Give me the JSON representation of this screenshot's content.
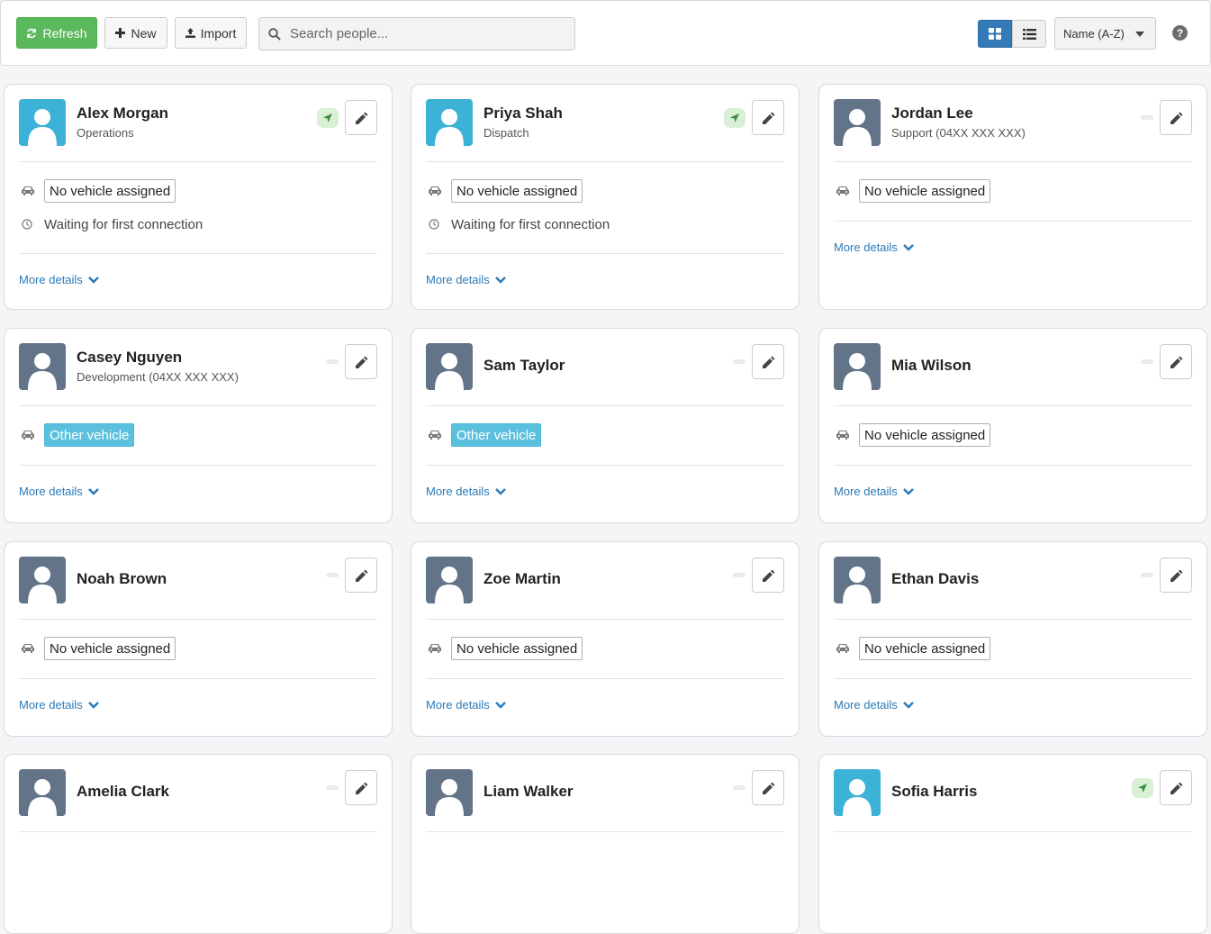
{
  "toolbar": {
    "refresh_label": "Refresh",
    "new_label": "New",
    "import_label": "Import",
    "search_placeholder": "Search people...",
    "sort_value": "Name (A-Z)",
    "help_label": "?"
  },
  "colors": {
    "accent": "#337ab7",
    "refresh": "#5cb85c",
    "avatar_online": "#3bb2d6",
    "avatar_offline": "#637388",
    "link": "#2a7ab8",
    "other_vehicle": "#5bc0de"
  },
  "people": [
    {
      "name": "Alex Morgan",
      "subtitle": "Operations",
      "vehicle": "No vehicle assigned",
      "vehicle_type": "none",
      "status": "Waiting for first connection",
      "location_active": true,
      "avatar": "blue",
      "more": "More details"
    },
    {
      "name": "Priya Shah",
      "subtitle": "Dispatch",
      "vehicle": "No vehicle assigned",
      "vehicle_type": "none",
      "status": "Waiting for first connection",
      "location_active": true,
      "avatar": "blue",
      "more": "More details"
    },
    {
      "name": "Jordan Lee",
      "subtitle": "Support (04XX XXX XXX)",
      "vehicle": "No vehicle assigned",
      "vehicle_type": "none",
      "status": "",
      "location_active": false,
      "avatar": "slate",
      "more": "More details"
    },
    {
      "name": "Casey Nguyen",
      "subtitle": "Development (04XX XXX XXX)",
      "vehicle": "Other vehicle",
      "vehicle_type": "other",
      "status": "",
      "location_active": false,
      "avatar": "slate",
      "more": "More details"
    },
    {
      "name": "Sam Taylor",
      "subtitle": "",
      "vehicle": "Other vehicle",
      "vehicle_type": "other",
      "status": "",
      "location_active": false,
      "avatar": "slate",
      "more": "More details"
    },
    {
      "name": "Mia Wilson",
      "subtitle": "",
      "vehicle": "No vehicle assigned",
      "vehicle_type": "none",
      "status": "",
      "location_active": false,
      "avatar": "slate",
      "more": "More details"
    },
    {
      "name": "Noah Brown",
      "subtitle": "",
      "vehicle": "No vehicle assigned",
      "vehicle_type": "none",
      "status": "",
      "location_active": false,
      "avatar": "slate",
      "more": "More details"
    },
    {
      "name": "Zoe Martin",
      "subtitle": "",
      "vehicle": "No vehicle assigned",
      "vehicle_type": "none",
      "status": "",
      "location_active": false,
      "avatar": "slate",
      "more": "More details"
    },
    {
      "name": "Ethan Davis",
      "subtitle": "",
      "vehicle": "No vehicle assigned",
      "vehicle_type": "none",
      "status": "",
      "location_active": false,
      "avatar": "slate",
      "more": "More details"
    },
    {
      "name": "Amelia Clark",
      "subtitle": "",
      "vehicle": "",
      "vehicle_type": "none",
      "status": "",
      "location_active": false,
      "avatar": "slate",
      "more": ""
    },
    {
      "name": "Liam Walker",
      "subtitle": "",
      "vehicle": "",
      "vehicle_type": "none",
      "status": "",
      "location_active": false,
      "avatar": "slate",
      "more": ""
    },
    {
      "name": "Sofia Harris",
      "subtitle": "",
      "vehicle": "",
      "vehicle_type": "none",
      "status": "",
      "location_active": true,
      "avatar": "blue",
      "more": ""
    }
  ]
}
